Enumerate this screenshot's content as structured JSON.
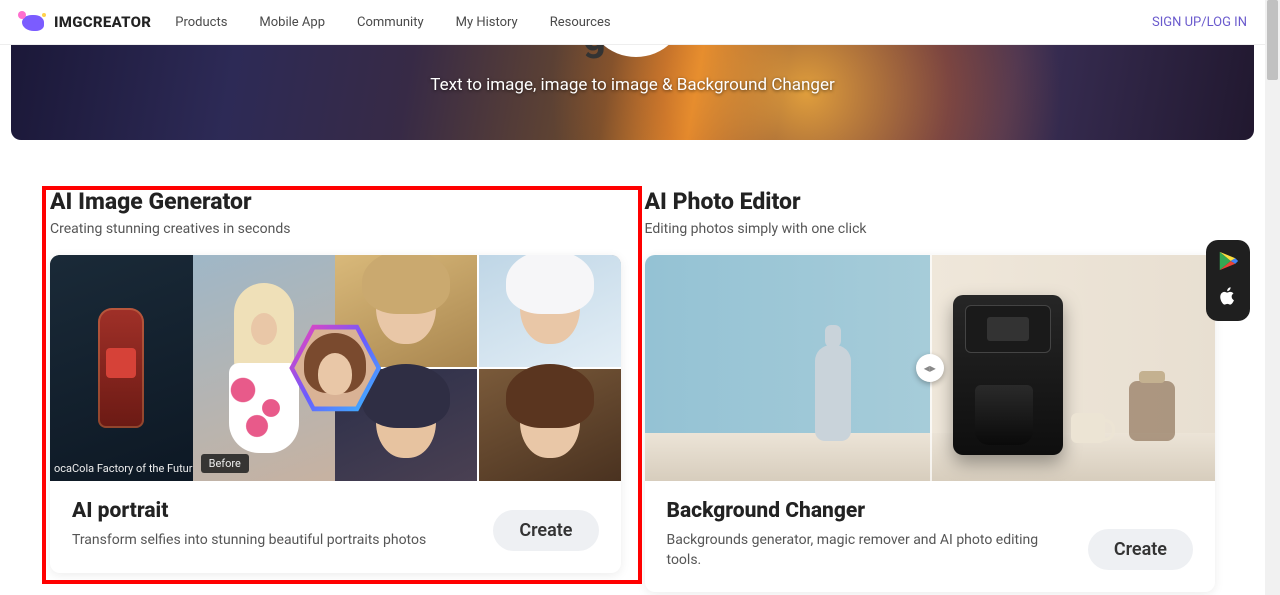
{
  "brand": "IMGCREATOR",
  "nav": {
    "items": [
      "Products",
      "Mobile App",
      "Community",
      "My History",
      "Resources"
    ],
    "auth": "SIGN UP/LOG IN"
  },
  "hero": {
    "tagline": "Text to image, image to image & Background Changer"
  },
  "sections": {
    "generator": {
      "title": "AI Image Generator",
      "subtitle": "Creating stunning creatives in seconds",
      "caption": "ocaCola Factory of the Futur",
      "before_label": "Before",
      "card": {
        "title": "AI portrait",
        "desc": "Transform selfies into stunning beautiful portraits photos",
        "cta": "Create"
      }
    },
    "editor": {
      "title": "AI Photo Editor",
      "subtitle": "Editing photos simply with one click",
      "card": {
        "title": "Background Changer",
        "desc": "Backgrounds generator, magic remover and AI photo editing tools.",
        "cta": "Create"
      }
    }
  },
  "app_links": {
    "play": "google-play",
    "apple": "apple-app-store"
  }
}
